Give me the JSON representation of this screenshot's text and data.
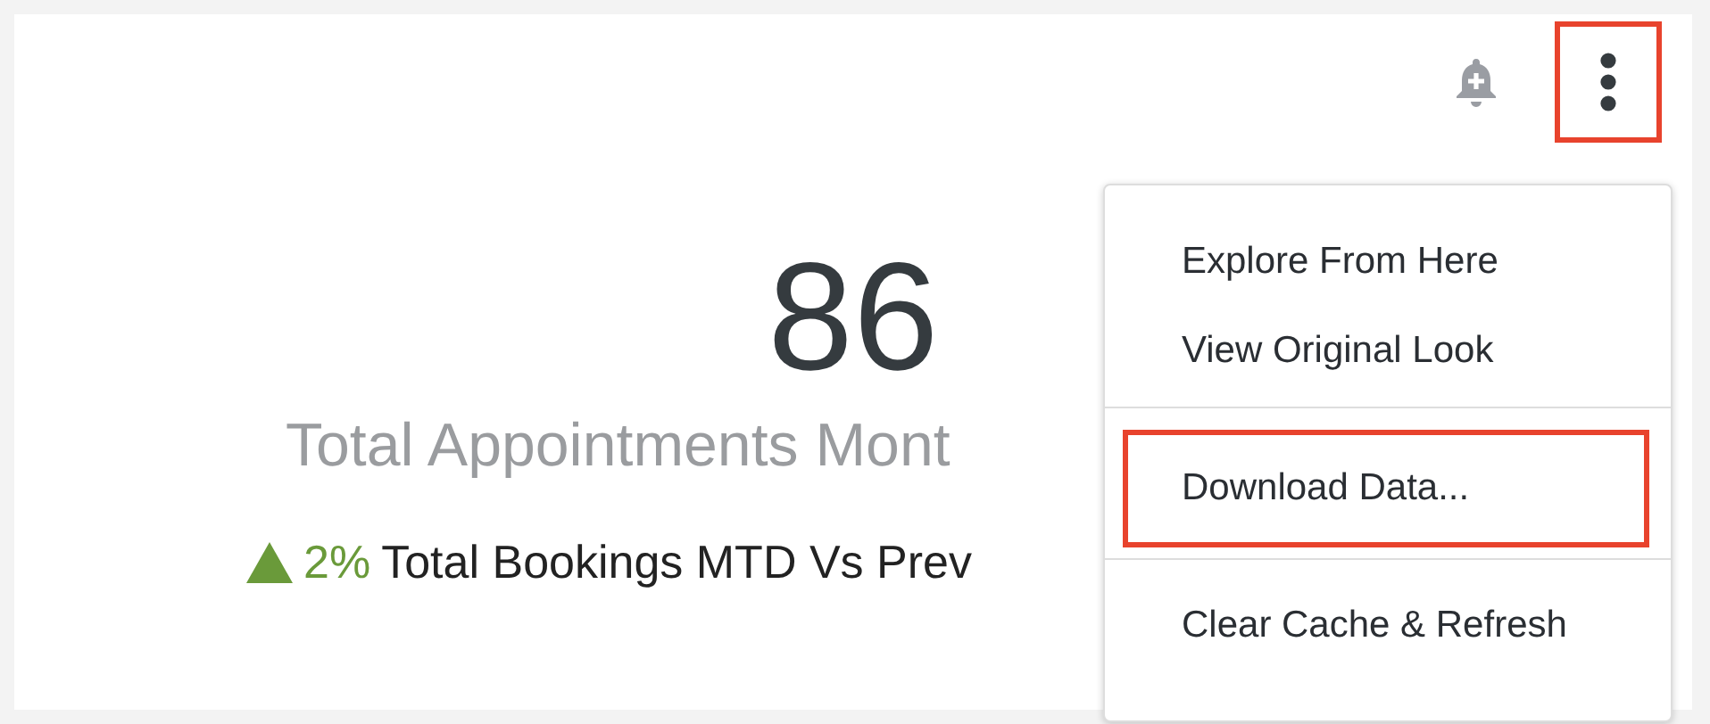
{
  "toolbar": {
    "alert_button": {
      "highlighted": false
    },
    "more_button": {
      "highlighted": true
    }
  },
  "tile": {
    "value": "86",
    "title": "Total Appointments Mont",
    "change": {
      "increase": true,
      "percent": "2%",
      "label": "Total Bookings MTD Vs Prev"
    }
  },
  "menu": {
    "groups": [
      [
        {
          "label": "Explore From Here",
          "highlighted": false
        },
        {
          "label": "View Original Look",
          "highlighted": false
        }
      ],
      [
        {
          "label": "Download Data...",
          "highlighted": true
        }
      ],
      [
        {
          "label": "Clear Cache & Refresh",
          "highlighted": false
        }
      ]
    ]
  }
}
